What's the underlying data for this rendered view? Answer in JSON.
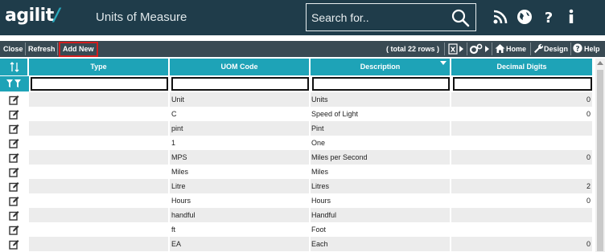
{
  "header": {
    "logo_main": "agilit",
    "logo_slash": "/",
    "title": "Units of Measure",
    "search_placeholder": "Search for.."
  },
  "header_icons": [
    "rss-icon",
    "globe-icon",
    "help-icon",
    "info-icon"
  ],
  "toolbar": {
    "close": "Close",
    "refresh": "Refresh",
    "add_new": "Add New",
    "total": "( total 22 rows )",
    "home": "Home",
    "design": "Design",
    "help": "Help"
  },
  "columns": [
    "Type",
    "UOM Code",
    "Description",
    "Decimal Digits"
  ],
  "rows": [
    {
      "type": "",
      "uom": "Unit",
      "desc": "Units",
      "dec": "0"
    },
    {
      "type": "",
      "uom": "C",
      "desc": "Speed of Light",
      "dec": "0"
    },
    {
      "type": "",
      "uom": "pint",
      "desc": "Pint",
      "dec": ""
    },
    {
      "type": "",
      "uom": "1",
      "desc": "One",
      "dec": ""
    },
    {
      "type": "",
      "uom": "MPS",
      "desc": "Miles per Second",
      "dec": "0"
    },
    {
      "type": "",
      "uom": "Miles",
      "desc": "Miles",
      "dec": ""
    },
    {
      "type": "",
      "uom": "Litre",
      "desc": "Litres",
      "dec": "2"
    },
    {
      "type": "",
      "uom": "Hours",
      "desc": "Hours",
      "dec": "0"
    },
    {
      "type": "",
      "uom": "handful",
      "desc": "Handful",
      "dec": ""
    },
    {
      "type": "",
      "uom": "ft",
      "desc": "Foot",
      "dec": ""
    },
    {
      "type": "",
      "uom": "EA",
      "desc": "Each",
      "dec": "0"
    }
  ],
  "colors": {
    "header_bg": "#1f3c4a",
    "toolbar_bg": "#394a53",
    "grid_header": "#1ea3b7",
    "row_alt": "#ececec",
    "highlight": "#d21e1e"
  }
}
